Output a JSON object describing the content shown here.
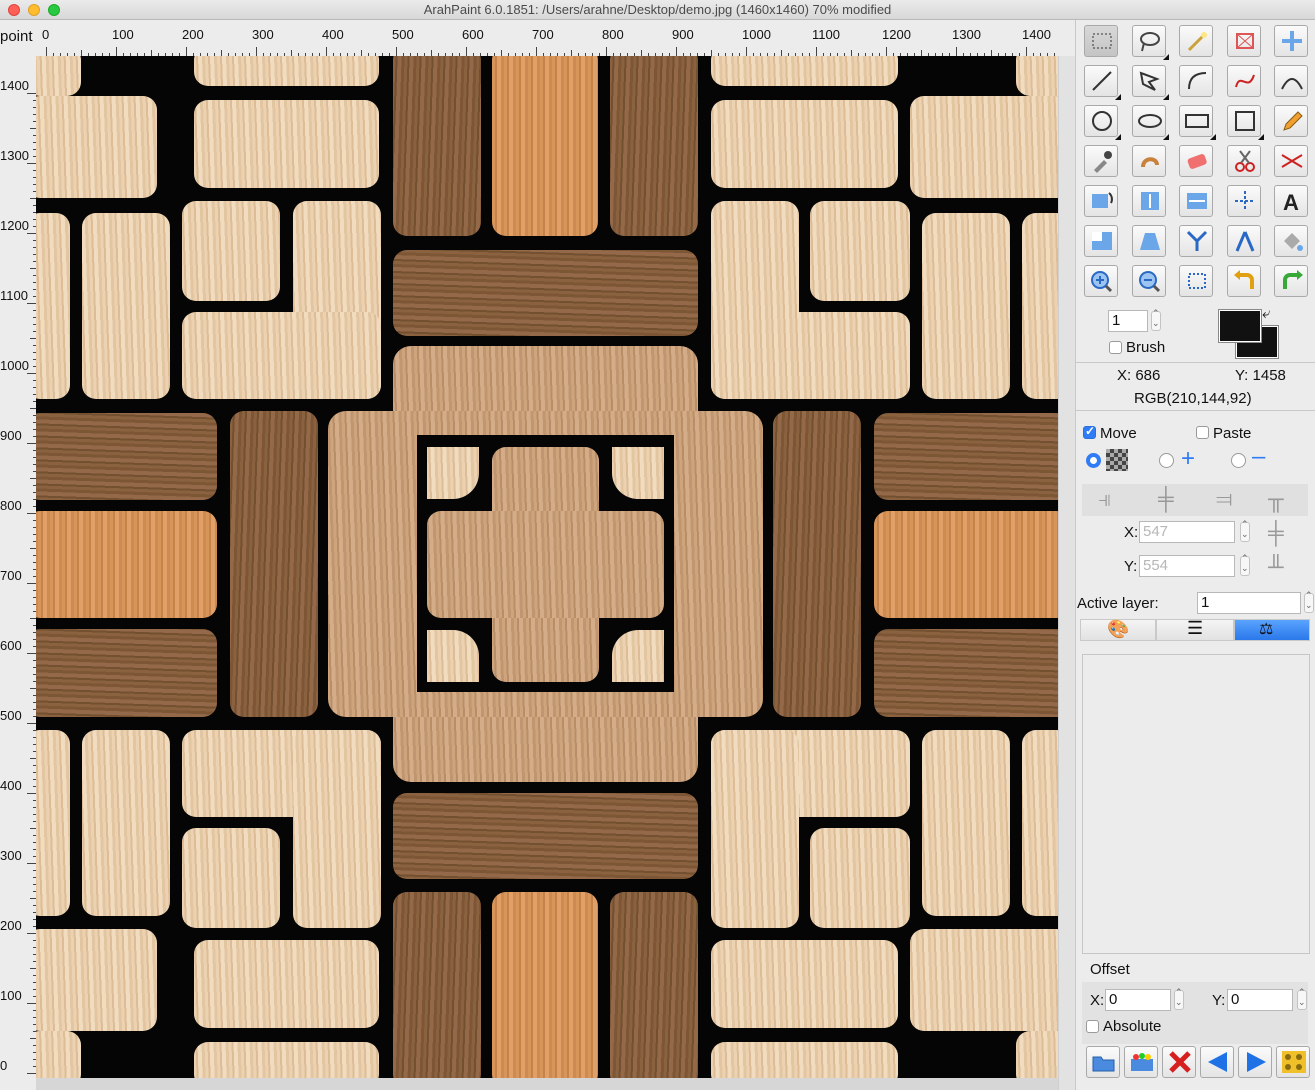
{
  "window": {
    "title": "ArahPaint 6.0.1851: /Users/arahne/Desktop/demo.jpg  (1460x1460) 70% modified"
  },
  "ruler": {
    "unit": "point",
    "h_labels": [
      "0",
      "100",
      "200",
      "300",
      "400",
      "500",
      "600",
      "700",
      "800",
      "900",
      "1000",
      "1100",
      "1200",
      "1300",
      "1400"
    ],
    "v_labels": [
      "1400",
      "1300",
      "1200",
      "1100",
      "1000",
      "900",
      "800",
      "700",
      "600",
      "500",
      "400",
      "300",
      "200",
      "100",
      "0"
    ]
  },
  "toolbar": {
    "rows": [
      [
        "rectangle-select",
        "lasso-select",
        "magic-wand",
        "crop",
        "move"
      ],
      [
        "line",
        "polygon",
        "curve",
        "bezier",
        "bezier-edit"
      ],
      [
        "circle",
        "ellipse",
        "rectangle",
        "square",
        "pencil"
      ],
      [
        "eyedropper",
        "smudge",
        "eraser",
        "scissors",
        "cut-colors"
      ],
      [
        "rotate",
        "flip-vertical",
        "flip-horizontal",
        "symmetry",
        "text"
      ],
      [
        "resize",
        "perspective",
        "branch",
        "compass",
        "fill"
      ],
      [
        "zoom-in",
        "zoom-out",
        "fit-screen",
        "undo",
        "redo"
      ]
    ],
    "selected": "rectangle-select"
  },
  "brush": {
    "size": "1",
    "label": "Brush",
    "checked": false
  },
  "colors": {
    "foreground": "#111111",
    "background": "#111111"
  },
  "status": {
    "x": "X: 686",
    "y": "Y: 1458",
    "rgb": "RGB(210,144,92)"
  },
  "selection": {
    "move_label": "Move",
    "move_checked": true,
    "paste_label": "Paste",
    "paste_checked": false,
    "x_label": "X:",
    "x_value": "547",
    "y_label": "Y:",
    "y_value": "554"
  },
  "layers": {
    "active_label": "Active layer:",
    "active_value": "1",
    "tabs": [
      "palette",
      "layers",
      "stamp"
    ],
    "selected_tab": "stamp"
  },
  "offset": {
    "title": "Offset",
    "x_label": "X:",
    "x_value": "0",
    "y_label": "Y:",
    "y_value": "0",
    "absolute_label": "Absolute",
    "absolute_checked": false
  },
  "bottom_buttons": [
    "open-folder",
    "colors",
    "delete",
    "previous",
    "next",
    "pattern"
  ]
}
